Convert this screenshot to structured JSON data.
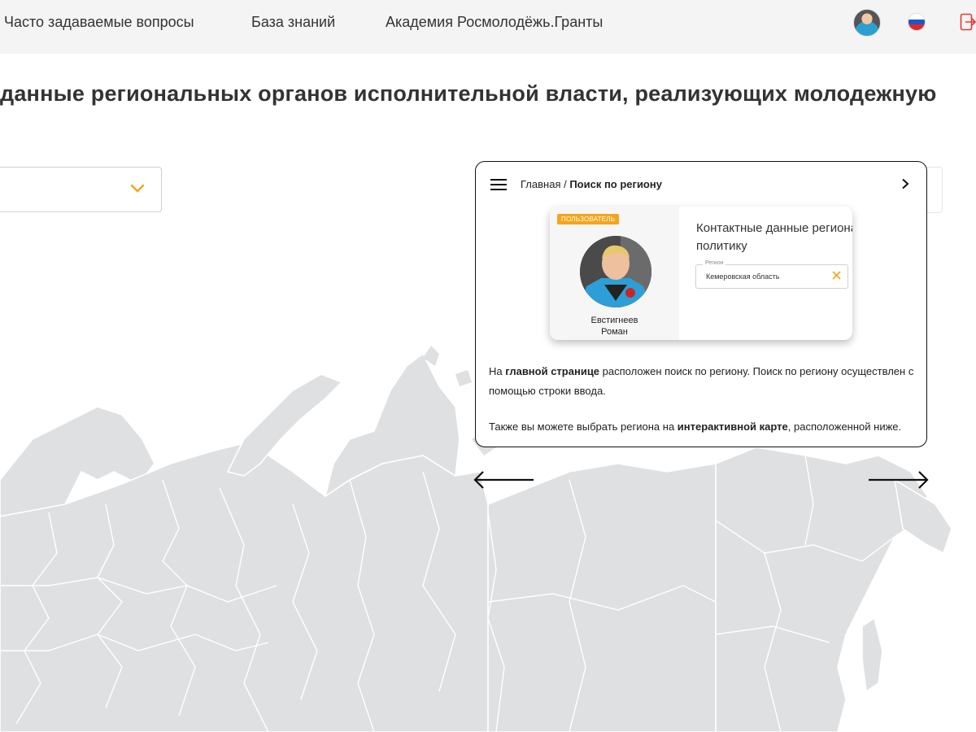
{
  "nav": {
    "items": [
      {
        "label": "Часто задаваемые вопросы"
      },
      {
        "label": "База знаний"
      },
      {
        "label": "Академия Росмолодёжь.Гранты"
      }
    ]
  },
  "page": {
    "title": "данные региональных органов исполнительной власти, реализующих молодежную"
  },
  "tour": {
    "breadcrumb_home": "Главная / ",
    "breadcrumb_current": "Поиск по региону",
    "preview": {
      "badge": "ПОЛЬЗОВАТЕЛЬ",
      "user_name_line1": "Евстигнеев",
      "user_name_line2": "Роман",
      "title_line1": "Контактные данные региона",
      "title_line2": "политику",
      "field_label": "Регион",
      "field_value": "Кемеровская область"
    },
    "p1_a": "На ",
    "p1_b": "главной странице",
    "p1_c": " расположен поиск по региону. Поиск по региону осуществлен с помощью строки ввода.",
    "p2_a": "Также вы можете выбрать региона на ",
    "p2_b": "интерактивной карте",
    "p2_c": ", расположенной ниже."
  },
  "colors": {
    "accent": "#f6a41a",
    "map_fill": "#dfe0e2",
    "map_border": "#ffffff",
    "logout": "#e53935"
  }
}
